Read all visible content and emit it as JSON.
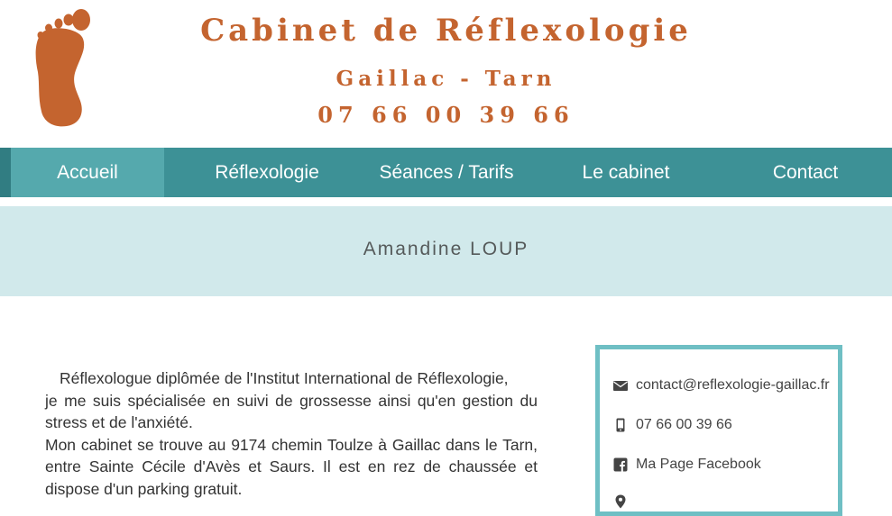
{
  "header": {
    "title": "Cabinet de Réflexologie",
    "location": "Gaillac - Tarn",
    "phone": "07 66 00 39 66",
    "logo_icon": "foot-icon"
  },
  "nav": {
    "items": [
      {
        "label": "Accueil",
        "active": true
      },
      {
        "label": "Réflexologie"
      },
      {
        "label": "Séances / Tarifs"
      },
      {
        "label": "Le cabinet"
      },
      {
        "label": "Contact"
      }
    ]
  },
  "banner": {
    "title": "Amandine LOUP"
  },
  "main": {
    "paragraph1": "Réflexologue diplômée de l'Institut International de Réflexologie,",
    "paragraph2": "je me suis spécialisée en suivi de grossesse ainsi qu'en gestion du stress et de l'anxiété.",
    "paragraph3": "Mon cabinet se trouve au 9174 chemin Toulze à Gaillac dans le Tarn, entre Sainte Cécile d'Avès et Saurs. Il est en rez de chaussée et dispose d'un parking gratuit."
  },
  "contact": {
    "email": "contact@reflexologie-gaillac.fr",
    "phone": "07 66 00 39 66",
    "facebook": "Ma Page Facebook"
  },
  "colors": {
    "brand": "#c4642f",
    "nav": "#3d9196",
    "nav_active": "#55a9ad",
    "banner": "#d1e9eb",
    "box_border": "#6fbfc4"
  }
}
